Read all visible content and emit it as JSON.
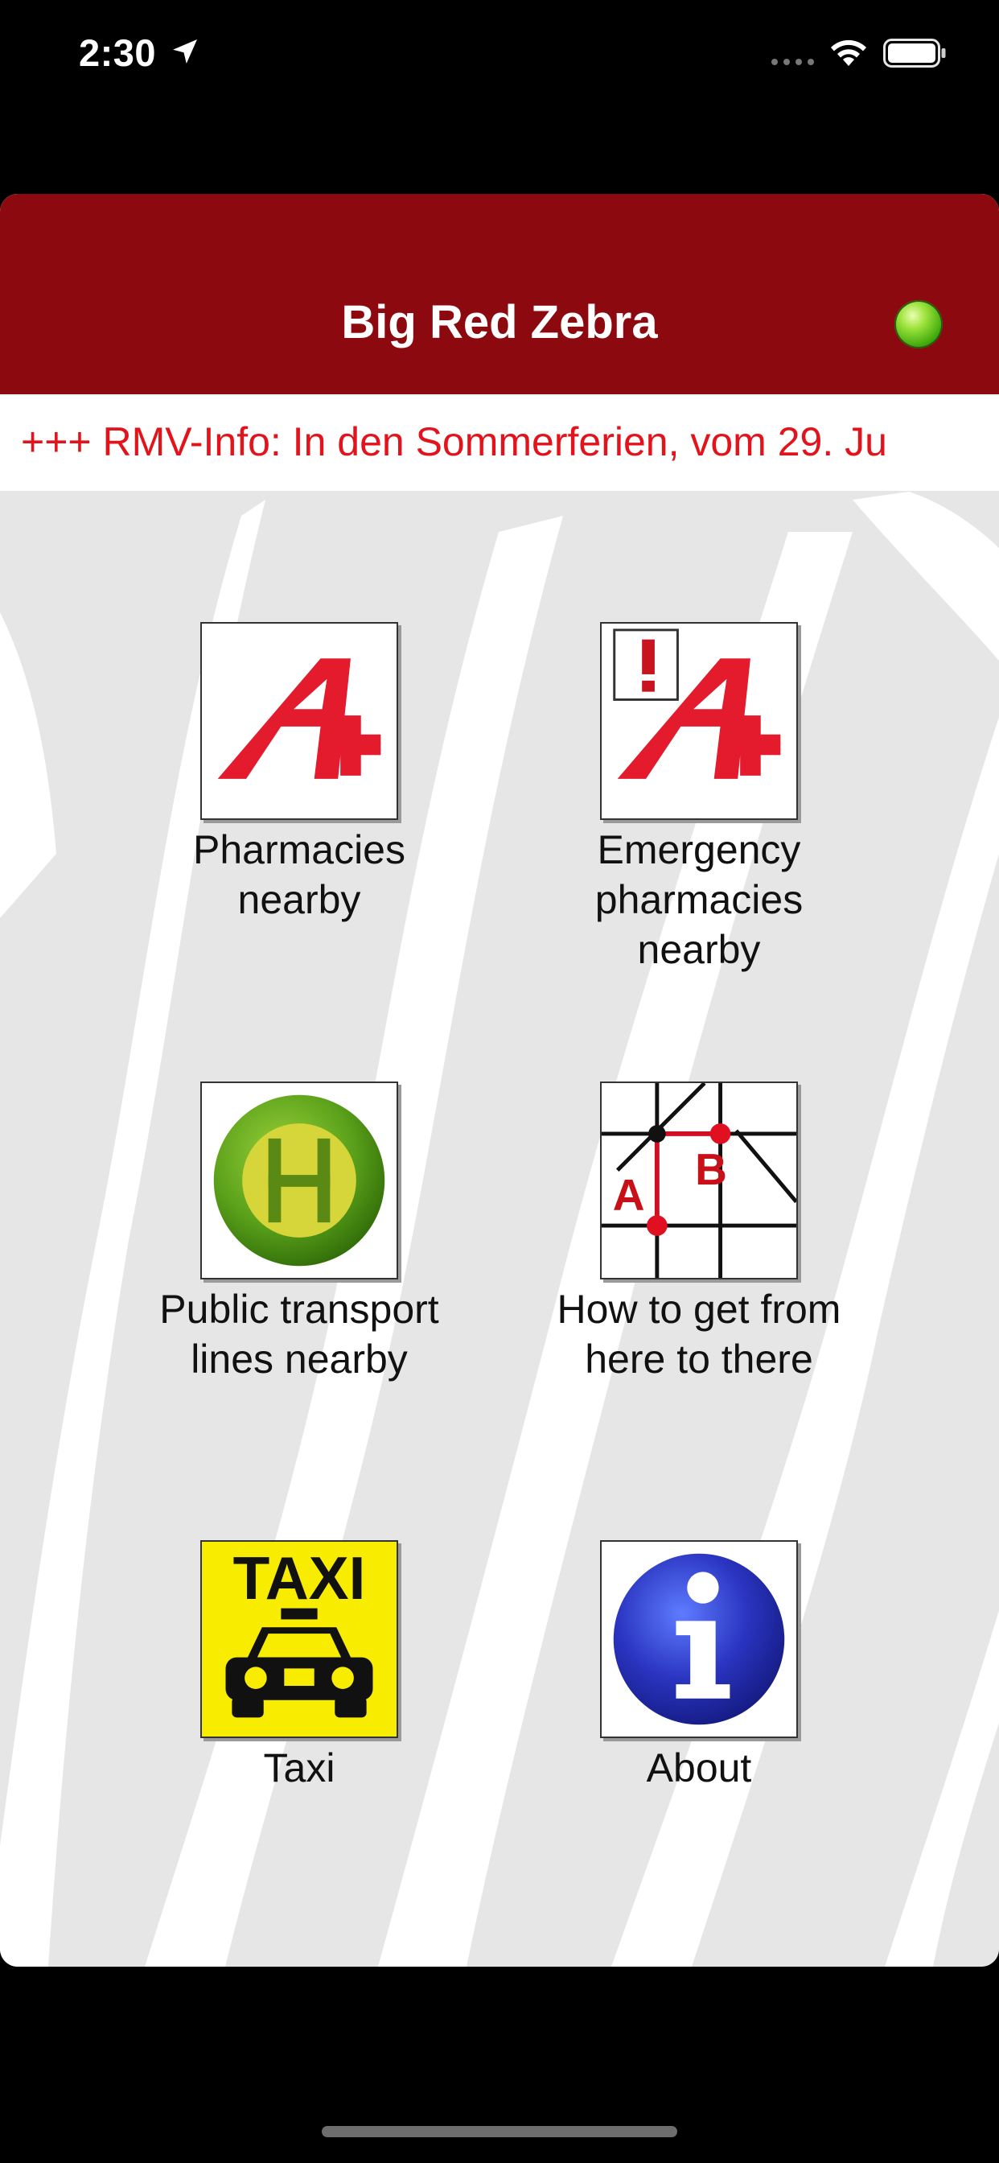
{
  "status_bar": {
    "time": "2:30"
  },
  "header": {
    "title": "Big Red Zebra"
  },
  "ticker": {
    "text": "+++ RMV-Info: In den Sommerferien, vom 29. Ju"
  },
  "tiles": [
    {
      "label": "Pharmacies nearby",
      "icon": "pharmacy-a-plus-icon"
    },
    {
      "label": "Emergency pharmacies nearby",
      "icon": "emergency-pharmacy-icon"
    },
    {
      "label": "Public transport lines nearby",
      "icon": "bus-stop-h-icon"
    },
    {
      "label": "How to get from here to there",
      "icon": "route-map-icon"
    },
    {
      "label": "Taxi",
      "icon": "taxi-icon"
    },
    {
      "label": "About",
      "icon": "info-icon"
    }
  ],
  "icon_text": {
    "taxi": "TAXI"
  },
  "colors": {
    "header": "#8c0a0f",
    "ticker_text": "#e3131b",
    "status_dot": "#5cc21a"
  }
}
